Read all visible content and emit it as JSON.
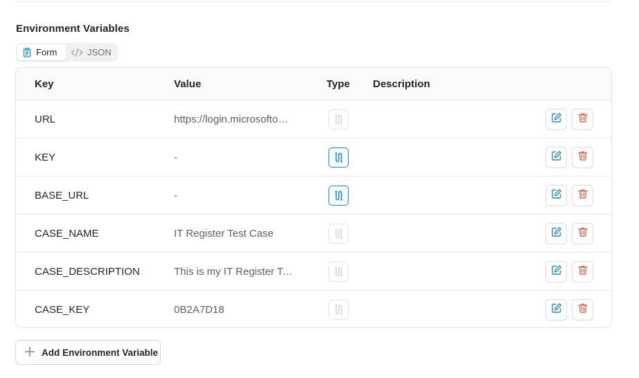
{
  "section": {
    "title": "Environment Variables"
  },
  "view_toggle": {
    "form_label": "Form",
    "json_label": "JSON",
    "active": "form"
  },
  "table": {
    "headers": {
      "key": "Key",
      "value": "Value",
      "type": "Type",
      "description": "Description"
    },
    "rows": [
      {
        "key": "URL",
        "value": "https://login.microsoftonline.com",
        "type_active": false,
        "description": ""
      },
      {
        "key": "KEY",
        "value": "-",
        "type_active": true,
        "description": ""
      },
      {
        "key": "BASE_URL",
        "value": "-",
        "type_active": true,
        "description": ""
      },
      {
        "key": "CASE_NAME",
        "value": "IT Register Test Case",
        "type_active": false,
        "description": ""
      },
      {
        "key": "CASE_DESCRIPTION",
        "value": "This is my IT Register Test Case",
        "type_active": false,
        "description": ""
      },
      {
        "key": "CASE_KEY",
        "value": "0B2A7D18",
        "type_active": false,
        "description": ""
      }
    ],
    "row_icons": {
      "type": "route-icon",
      "edit": "edit-icon",
      "delete": "trash-icon"
    }
  },
  "add_button": {
    "label": "Add Environment Variable",
    "icon": "plus-icon"
  },
  "colors": {
    "accent": "#1d8fc4",
    "danger": "#d9694e",
    "muted_icon": "#d4d4d9"
  }
}
